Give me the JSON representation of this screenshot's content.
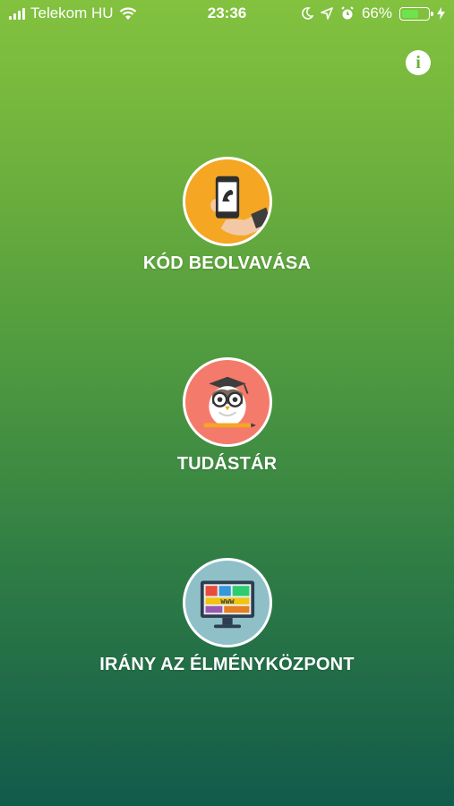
{
  "status_bar": {
    "carrier": "Telekom HU",
    "time": "23:36",
    "battery": "66%",
    "battery_level": 0.66
  },
  "info_button": {
    "label": "i"
  },
  "menu": {
    "items": [
      {
        "label": "KÓD BEOLVAVÁSA",
        "icon": "phone-scan-icon",
        "color": "#f5a623"
      },
      {
        "label": "TUDÁSTÁR",
        "icon": "owl-graduate-icon",
        "color": "#f47b6b"
      },
      {
        "label": "IRÁNY AZ ÉLMÉNYKÖZPONT",
        "icon": "monitor-www-icon",
        "color": "#8fc0c8"
      }
    ],
    "www_text": "www"
  }
}
